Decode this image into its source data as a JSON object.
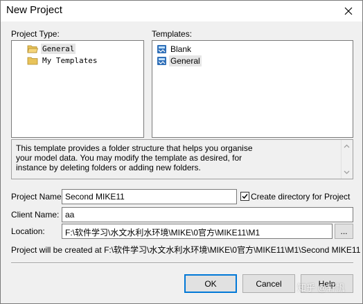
{
  "window": {
    "title": "New Project"
  },
  "project_type": {
    "label": "Project Type:",
    "items": [
      {
        "label": "General",
        "icon": "folder-open-icon",
        "selected": true
      },
      {
        "label": "My Templates",
        "icon": "folder-icon",
        "selected": false
      }
    ]
  },
  "templates": {
    "label": "Templates:",
    "items": [
      {
        "label": "Blank",
        "icon": "template-icon",
        "selected": false
      },
      {
        "label": "General",
        "icon": "template-icon",
        "selected": true
      }
    ]
  },
  "description": "This template provides a folder structure that helps you organise\nyour model data. You may modify the template as desired, for\ninstance by deleting folders or adding new folders.",
  "form": {
    "project_name_label": "Project Name:",
    "project_name_value": "Second MIKE11",
    "create_directory_label": "Create directory for Project",
    "create_directory_checked": true,
    "client_name_label": "Client Name:",
    "client_name_value": "aa",
    "location_label": "Location:",
    "location_value": "F:\\软件学习\\水文水利水环境\\MIKE\\0官方\\MIKE11\\M1",
    "browse_label": "...",
    "created_at_text": "Project will be created at F:\\软件学习\\水文水利水环境\\MIKE\\0官方\\MIKE11\\M1\\Second MIKE11"
  },
  "buttons": {
    "ok": "OK",
    "cancel": "Cancel",
    "help": "Help"
  },
  "watermark": "知乎 @轩帆",
  "colors": {
    "title_bar": "#ffffff",
    "dialog_bg": "#f0f0f0",
    "default_button_border": "#0078d7",
    "folder": "#e8c35a",
    "template_icon": "#2f6fb8"
  }
}
